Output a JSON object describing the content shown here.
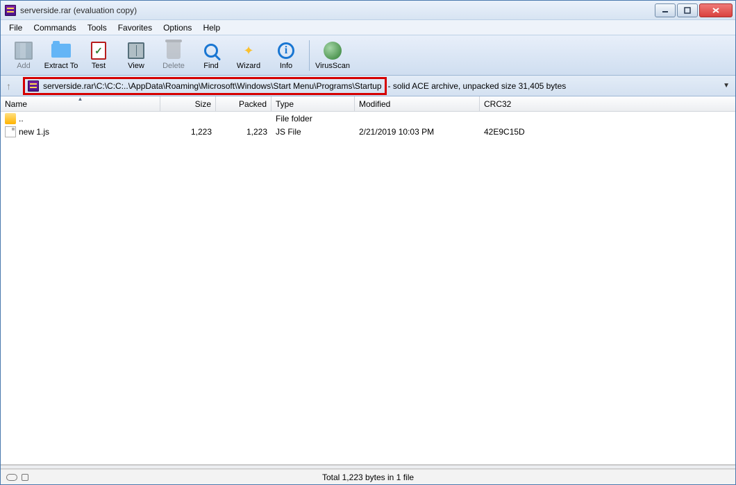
{
  "window": {
    "title": "serverside.rar (evaluation copy)"
  },
  "menubar": {
    "file": "File",
    "commands": "Commands",
    "tools": "Tools",
    "favorites": "Favorites",
    "options": "Options",
    "help": "Help"
  },
  "toolbar": {
    "add": "Add",
    "extract": "Extract To",
    "test": "Test",
    "view": "View",
    "delete": "Delete",
    "find": "Find",
    "wizard": "Wizard",
    "info": "Info",
    "virusscan": "VirusScan"
  },
  "pathbar": {
    "path": "serverside.rar\\C:\\C:C:..\\AppData\\Roaming\\Microsoft\\Windows\\Start Menu\\Programs\\Startup",
    "archive_info": "- solid ACE archive, unpacked size 31,405 bytes"
  },
  "columns": {
    "name": "Name",
    "size": "Size",
    "packed": "Packed",
    "type": "Type",
    "modified": "Modified",
    "crc32": "CRC32"
  },
  "rows": {
    "up": {
      "name": "..",
      "type": "File folder"
    },
    "file1": {
      "name": "new 1.js",
      "size": "1,223",
      "packed": "1,223",
      "type": "JS File",
      "modified": "2/21/2019 10:03 PM",
      "crc32": "42E9C15D"
    }
  },
  "statusbar": {
    "center": "Total 1,223 bytes in 1 file"
  }
}
